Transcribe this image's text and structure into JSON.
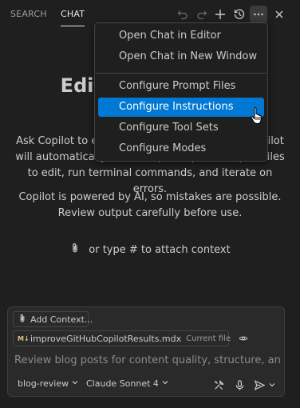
{
  "tabs": [
    {
      "label": "SEARCH",
      "active": false
    },
    {
      "label": "CHAT",
      "active": true
    }
  ],
  "toolbar_icons": [
    "undo-icon",
    "redo-icon",
    "new-chat-icon",
    "history-icon",
    "more-icon",
    "close-icon"
  ],
  "welcome": {
    "title": "Edit with Copilot",
    "para1": "Ask Copilot to edit your files in agent mode. Copilot will automatically use multiple requests to pick files to edit, run terminal commands, and iterate on errors.",
    "para2": "Copilot is powered by AI, so mistakes are possible. Review output carefully before use.",
    "attach_hint": "or type # to attach context"
  },
  "input": {
    "add_context_label": "Add Context...",
    "file_name": "improveGitHubCopilotResults.mdx",
    "file_badge": "Current file",
    "text": "Review blog posts for content quality, structure, and techn",
    "mode_label": "blog-review",
    "model_label": "Claude Sonnet 4"
  },
  "menu": {
    "items": [
      {
        "label": "Open Chat in Editor"
      },
      {
        "label": "Open Chat in New Window"
      },
      {
        "label": "Configure Prompt Files"
      },
      {
        "label": "Configure Instructions",
        "highlighted": true
      },
      {
        "label": "Configure Tool Sets"
      },
      {
        "label": "Configure Modes"
      }
    ]
  },
  "colors": {
    "background": "#1f1f1f",
    "highlight": "#0078d4",
    "text": "#cccccc"
  }
}
